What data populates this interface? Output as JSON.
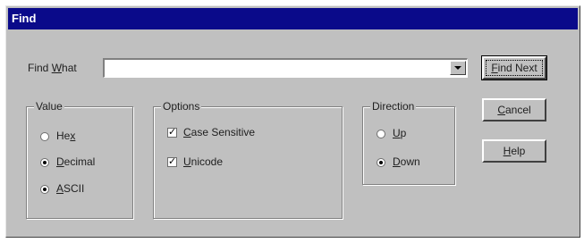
{
  "window": {
    "title": "Find"
  },
  "find_what": {
    "label_prefix": "Find ",
    "label_mnemonic": "W",
    "label_suffix": "hat",
    "value": ""
  },
  "value_group": {
    "title": "Value",
    "options": [
      {
        "pre": "He",
        "mn": "x",
        "post": "",
        "checked": false
      },
      {
        "pre": "",
        "mn": "D",
        "post": "ecimal",
        "checked": true
      },
      {
        "pre": "",
        "mn": "A",
        "post": "SCII",
        "checked": true
      }
    ]
  },
  "options_group": {
    "title": "Options",
    "case_sensitive": {
      "pre": "",
      "mn": "C",
      "post": "ase Sensitive",
      "checked": true
    },
    "unicode": {
      "pre": "",
      "mn": "U",
      "post": "nicode",
      "checked": true
    }
  },
  "direction_group": {
    "title": "Direction",
    "up": {
      "pre": "",
      "mn": "U",
      "post": "p",
      "checked": false
    },
    "down": {
      "pre": "",
      "mn": "D",
      "post": "own",
      "checked": true
    }
  },
  "buttons": {
    "find_next": {
      "mn": "F",
      "post": "ind Next"
    },
    "cancel": {
      "mn": "C",
      "post": "ancel"
    },
    "help": {
      "mn": "H",
      "post": "elp"
    }
  }
}
